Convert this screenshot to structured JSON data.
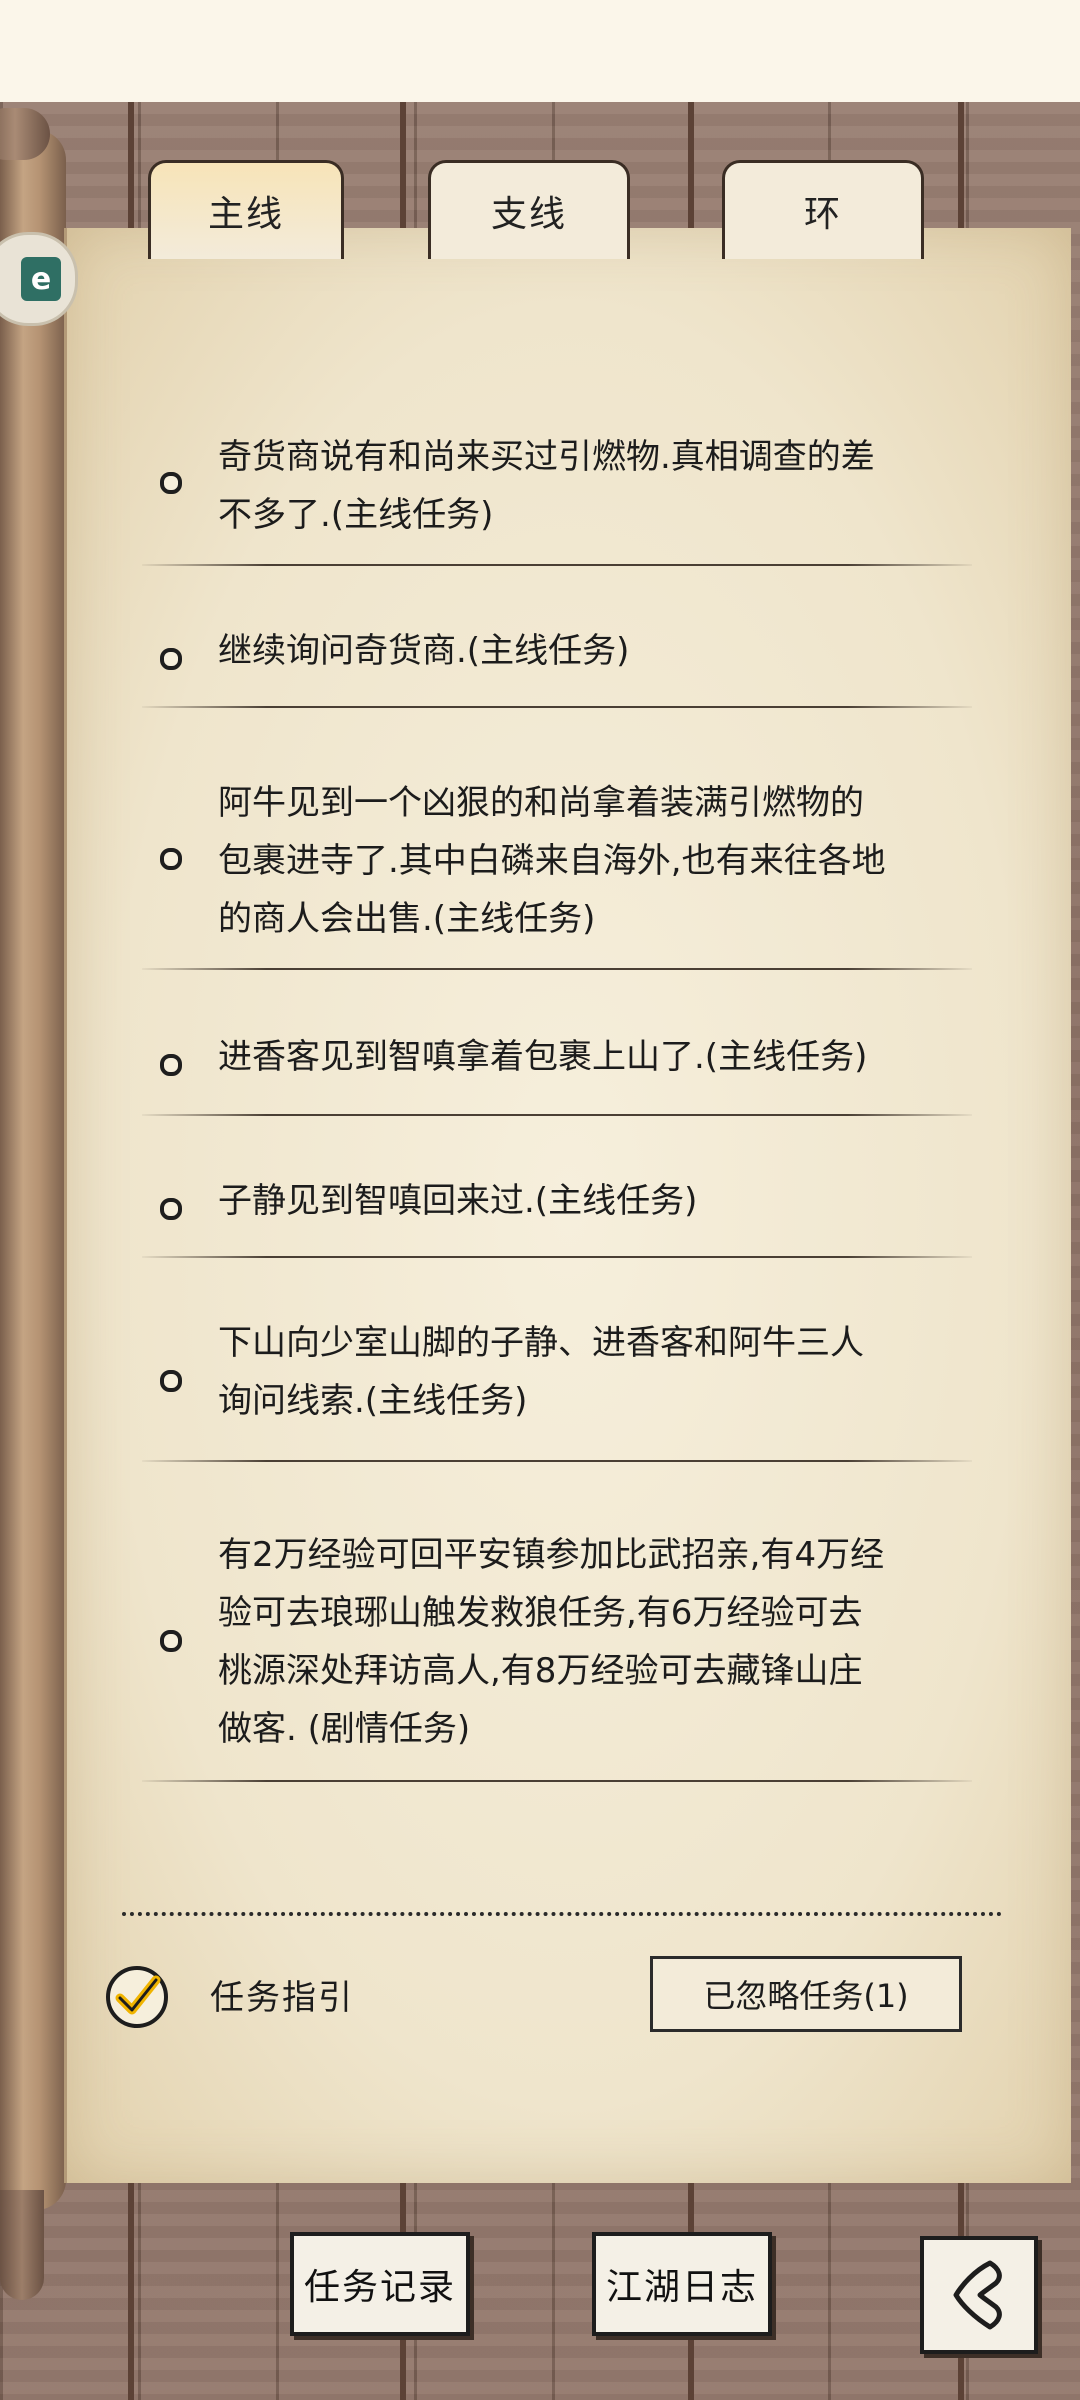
{
  "tabs": [
    {
      "label": "主线",
      "active": true
    },
    {
      "label": "支线",
      "active": false
    },
    {
      "label": "环",
      "active": false
    }
  ],
  "side_badge": {
    "glyph": "e"
  },
  "tasks": [
    {
      "text": "奇货商说有和尚来买过引燃物.真相调查的差\n不多了.(主线任务)"
    },
    {
      "text": "继续询问奇货商.(主线任务)"
    },
    {
      "text": "阿牛见到一个凶狠的和尚拿着装满引燃物的\n包裹进寺了.其中白磷来自海外,也有来往各地\n的商人会出售.(主线任务)"
    },
    {
      "text": "进香客见到智嗔拿着包裹上山了.(主线任务)"
    },
    {
      "text": "子静见到智嗔回来过.(主线任务)"
    },
    {
      "text": "下山向少室山脚的子静、进香客和阿牛三人\n询问线索.(主线任务)"
    },
    {
      "text": "有2万经验可回平安镇参加比武招亲,有4万经\n验可去琅琊山触发救狼任务,有6万经验可去\n桃源深处拜访高人,有8万经验可去藏锋山庄\n做客. (剧情任务)"
    }
  ],
  "guide": {
    "label": "任务指引",
    "checked": true
  },
  "ignored_button": {
    "label": "已忽略任务(1)"
  },
  "bottom_buttons": [
    {
      "label": "任务记录"
    },
    {
      "label": "江湖日志"
    }
  ],
  "colors": {
    "ink": "#1c1c1c",
    "parchment": "#f3ebd9",
    "wood": "#8d7266"
  },
  "icons": [
    "check-icon",
    "back-arrow-icon",
    "scroll-roll-icon"
  ]
}
